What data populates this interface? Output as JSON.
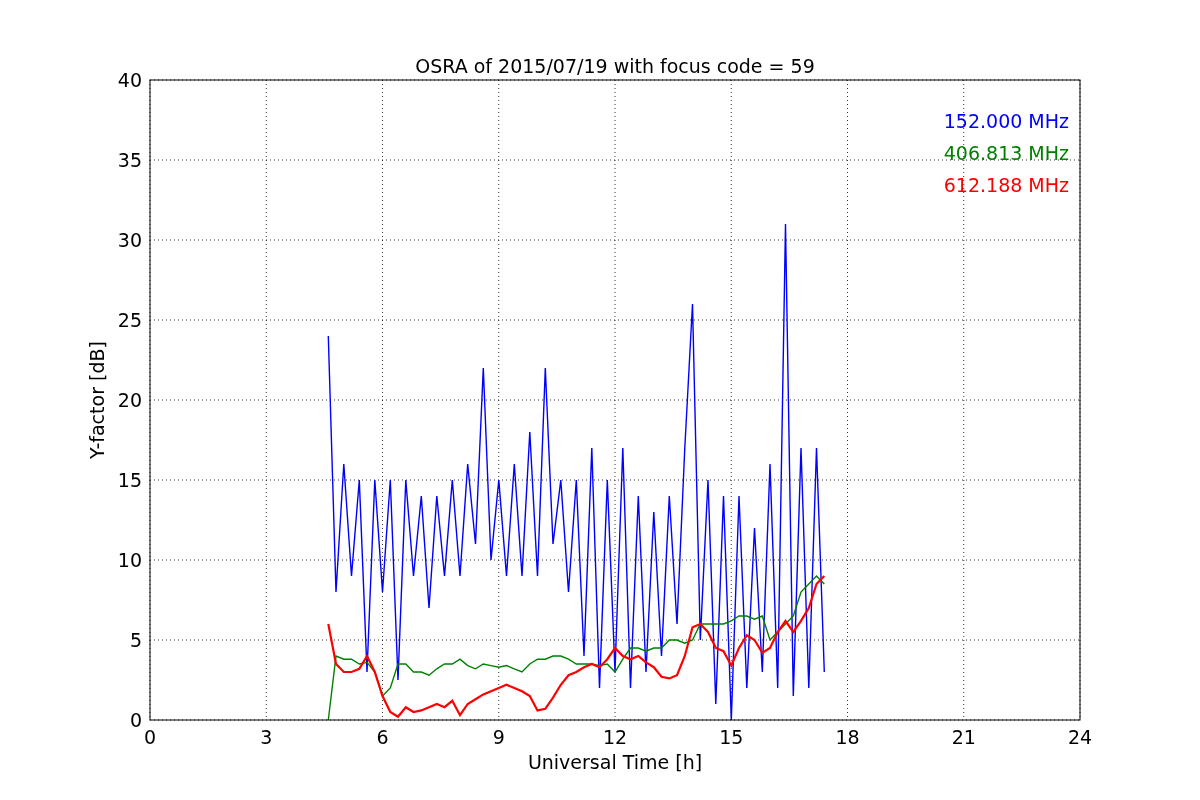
{
  "figure": {
    "chart_data": {
      "type": "line",
      "title": "OSRA of 2015/07/19 with focus code = 59",
      "xlabel": "Universal Time [h]",
      "ylabel": "Y-factor [dB]",
      "xlim": [
        0,
        24
      ],
      "ylim": [
        0,
        40
      ],
      "xticks": [
        0,
        3,
        6,
        9,
        12,
        15,
        18,
        21,
        24
      ],
      "yticks": [
        0,
        5,
        10,
        15,
        20,
        25,
        30,
        35,
        40
      ],
      "grid": true,
      "x": [
        4.6,
        4.8,
        5.0,
        5.2,
        5.4,
        5.6,
        5.8,
        6.0,
        6.2,
        6.4,
        6.6,
        6.8,
        7.0,
        7.2,
        7.4,
        7.6,
        7.8,
        8.0,
        8.2,
        8.4,
        8.6,
        8.8,
        9.0,
        9.2,
        9.4,
        9.6,
        9.8,
        10.0,
        10.2,
        10.4,
        10.6,
        10.8,
        11.0,
        11.2,
        11.4,
        11.6,
        11.8,
        12.0,
        12.2,
        12.4,
        12.6,
        12.8,
        13.0,
        13.2,
        13.4,
        13.6,
        13.8,
        14.0,
        14.2,
        14.4,
        14.6,
        14.8,
        15.0,
        15.2,
        15.4,
        15.6,
        15.8,
        16.0,
        16.2,
        16.4,
        16.6,
        16.8,
        17.0,
        17.2,
        17.4
      ],
      "series": [
        {
          "name": "152.000 MHz",
          "color": "#0000ff",
          "values": [
            24,
            8,
            16,
            9,
            15,
            3,
            15,
            8,
            15,
            2.5,
            15,
            9,
            14,
            7,
            14,
            9,
            15,
            9,
            16,
            11,
            22,
            10,
            15,
            9,
            16,
            9,
            18,
            9,
            22,
            11,
            15,
            8,
            15,
            4,
            17,
            2,
            15,
            3,
            17,
            2,
            14,
            3,
            13,
            4,
            14,
            6,
            17,
            26,
            5,
            15,
            1,
            14,
            0,
            14,
            2,
            12,
            3,
            16,
            2,
            31,
            1.5,
            17,
            2,
            17,
            3
          ]
        },
        {
          "name": "406.813 MHz",
          "color": "#008000",
          "values": [
            0,
            4,
            3.8,
            3.8,
            3.5,
            3.6,
            3,
            1.5,
            2,
            3.5,
            3.5,
            3,
            3,
            2.8,
            3.2,
            3.5,
            3.5,
            3.8,
            3.4,
            3.2,
            3.5,
            3.4,
            3.3,
            3.4,
            3.2,
            3,
            3.5,
            3.8,
            3.8,
            4,
            4,
            3.8,
            3.5,
            3.5,
            3.5,
            3.4,
            3.5,
            3,
            3.8,
            4.5,
            4.5,
            4.3,
            4.5,
            4.5,
            5,
            5,
            4.8,
            5,
            6,
            6,
            6,
            6,
            6.2,
            6.5,
            6.5,
            6.3,
            6.5,
            5,
            5.5,
            6,
            6.5,
            8,
            8.5,
            9,
            8.5
          ]
        },
        {
          "name": "612.188 MHz",
          "color": "#ff0000",
          "values": [
            6,
            3.5,
            3,
            3,
            3.2,
            4,
            3,
            1.5,
            0.5,
            0.2,
            0.8,
            0.5,
            0.6,
            0.8,
            1,
            0.8,
            1.2,
            0.3,
            1,
            1.3,
            1.6,
            1.8,
            2,
            2.2,
            2,
            1.8,
            1.5,
            0.6,
            0.7,
            1.4,
            2.2,
            2.8,
            3,
            3.3,
            3.5,
            3.3,
            3.8,
            4.5,
            4,
            3.8,
            4,
            3.6,
            3.3,
            2.7,
            2.6,
            2.8,
            4,
            5.8,
            6,
            5.5,
            4.5,
            4.3,
            3.4,
            4.5,
            5.3,
            5,
            4.2,
            4.5,
            5.5,
            6.2,
            5.5,
            6.2,
            7,
            8.5,
            9
          ]
        }
      ]
    }
  }
}
